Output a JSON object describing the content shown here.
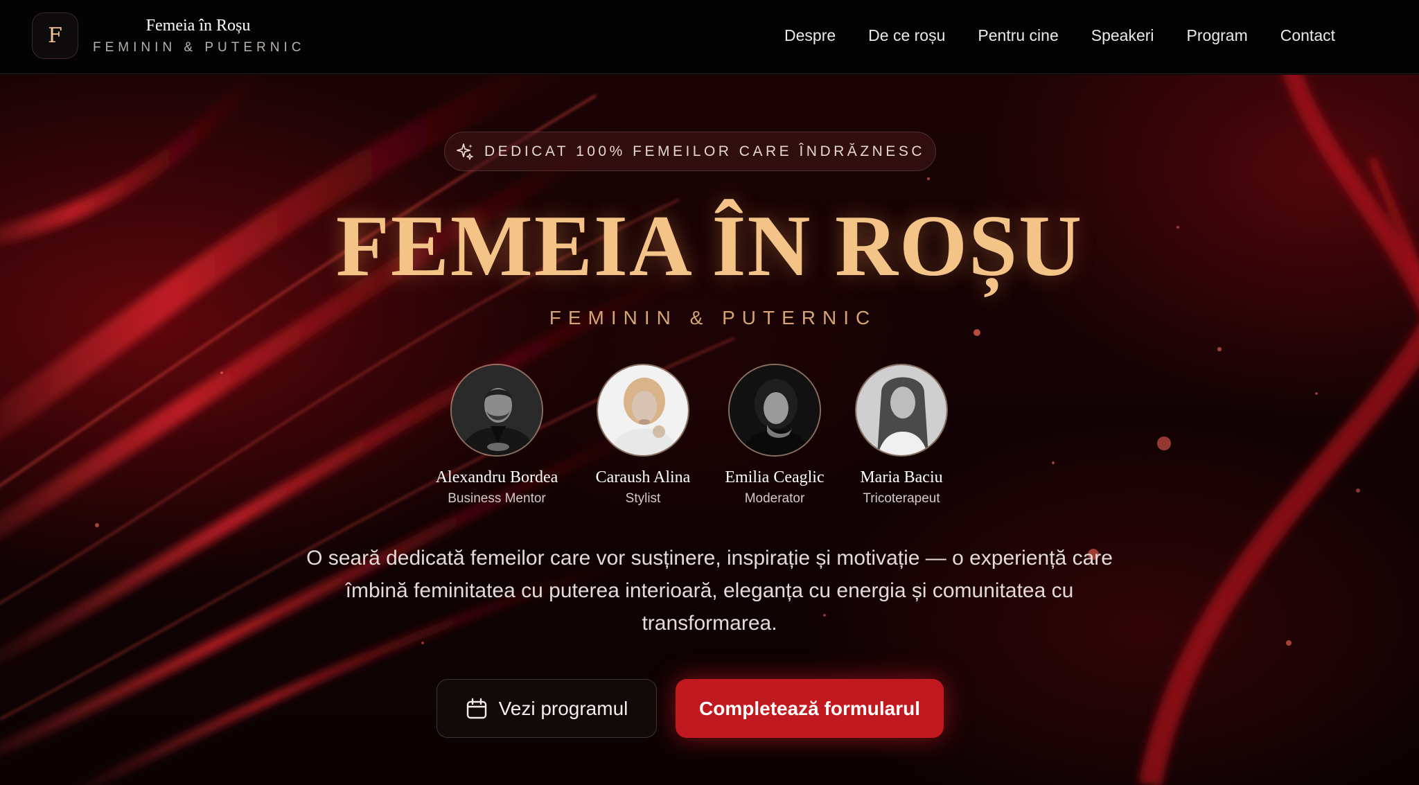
{
  "header": {
    "logo_letter": "F",
    "brand_title": "Femeia în Roșu",
    "brand_subtitle": "FEMININ & PUTERNIC",
    "nav": [
      "Despre",
      "De ce roșu",
      "Pentru cine",
      "Speakeri",
      "Program",
      "Contact"
    ]
  },
  "hero": {
    "badge": "DEDICAT 100% FEMEILOR CARE ÎNDRĂZNESC",
    "title": "FEMEIA ÎN ROȘU",
    "subtitle": "FEMININ & PUTERNIC",
    "speakers": [
      {
        "name": "Alexandru Bordea",
        "role": "Business Mentor",
        "photo": "man-dark-suit-portrait"
      },
      {
        "name": "Caraush Alina",
        "role": "Stylist",
        "photo": "blonde-woman-portrait"
      },
      {
        "name": "Emilia Ceaglic",
        "role": "Moderator",
        "photo": "dark-haired-woman-portrait"
      },
      {
        "name": "Maria Baciu",
        "role": "Tricoterapeut",
        "photo": "long-haired-woman-portrait"
      }
    ],
    "description": "O seară dedicată femeilor care vor susținere, inspirație și motivație — o experiență care îmbină feminitatea cu puterea interioară, eleganța cu energia și comunitatea cu transformarea.",
    "secondary_button": {
      "label": "Vezi programul",
      "icon": "calendar-icon"
    },
    "primary_button": {
      "label": "Completează formularul"
    }
  },
  "colors": {
    "accent_gold": "#f3c387",
    "accent_red": "#c0191f",
    "header_bg": "#030303"
  }
}
